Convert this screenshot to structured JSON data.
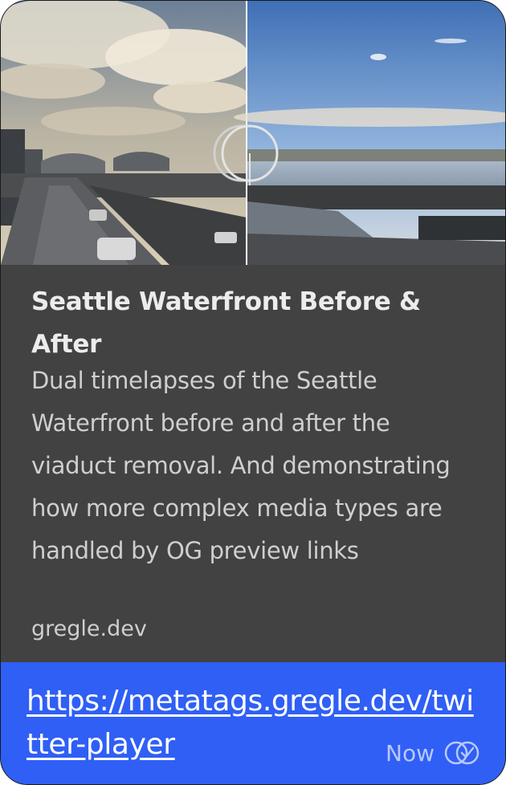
{
  "preview": {
    "image_alt": "Seattle Waterfront split before/after timelapse frame",
    "title": "Seattle Waterfront Before & After",
    "description": "Dual timelapses of the Seattle Waterfront before and after the viaduct removal. And demonstrating how more complex media types are handled by OG preview links",
    "domain": "gregle.dev"
  },
  "message": {
    "url": "https://metatags.gregle.dev/twitter-player",
    "timestamp": "Now",
    "status_icon": "read-double-check-icon"
  },
  "colors": {
    "card_bg": "#424242",
    "bubble_bg": "#2f5ff5",
    "title_text": "#ececec",
    "body_text": "#cfcfcf",
    "meta_text": "#b9c8ff"
  }
}
